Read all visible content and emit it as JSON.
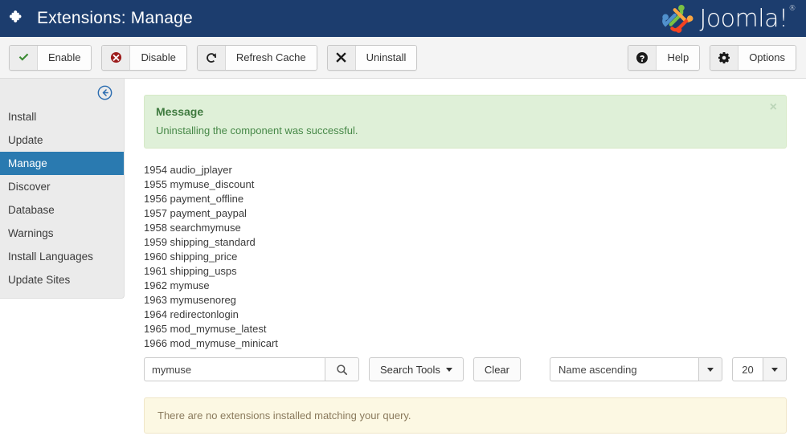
{
  "header": {
    "title": "Extensions: Manage",
    "icon": "puzzle-icon",
    "brand_name": "Joomla!",
    "brand_reg": "®",
    "bg_color": "#1c3d6e"
  },
  "toolbar": {
    "left_buttons": [
      {
        "label": "Enable",
        "icon": "check-icon"
      },
      {
        "label": "Disable",
        "icon": "circle-x-icon"
      },
      {
        "label": "Refresh Cache",
        "icon": "refresh-icon"
      },
      {
        "label": "Uninstall",
        "icon": "x-icon"
      }
    ],
    "right_buttons": [
      {
        "label": "Help",
        "icon": "question-circle-icon"
      },
      {
        "label": "Options",
        "icon": "gear-icon"
      }
    ]
  },
  "sidebar": {
    "collapse_icon": "arrow-left-circle-icon",
    "active_item": "Manage",
    "items": [
      {
        "label": "Install"
      },
      {
        "label": "Update"
      },
      {
        "label": "Manage"
      },
      {
        "label": "Discover"
      },
      {
        "label": "Database"
      },
      {
        "label": "Warnings"
      },
      {
        "label": "Install Languages"
      },
      {
        "label": "Update Sites"
      }
    ]
  },
  "main": {
    "message_alert": {
      "title": "Message",
      "text": "Uninstalling the component was successful.",
      "close_label": "×",
      "bg_color": "#dff0d8",
      "text_color": "#468847"
    },
    "id_list": [
      "1954 audio_jplayer",
      "1955 mymuse_discount",
      "1956 payment_offline",
      "1957 payment_paypal",
      "1958 searchmymuse",
      "1959 shipping_standard",
      "1960 shipping_price",
      "1961 shipping_usps",
      "1962 mymuse",
      "1963 mymusenoreg",
      "1964 redirectonlogin",
      "1965 mod_mymuse_latest",
      "1966 mod_mymuse_minicart"
    ],
    "filters": {
      "search_value": "mymuse",
      "search_placeholder": "Search",
      "search_icon": "search-icon",
      "search_tools_label": "Search Tools",
      "clear_label": "Clear",
      "sort_value": "Name ascending",
      "limit_value": "20"
    },
    "info_alert": {
      "text": "There are no extensions installed matching your query.",
      "bg_color": "#fcf8e3",
      "text_color": "#8a7a5c"
    }
  }
}
